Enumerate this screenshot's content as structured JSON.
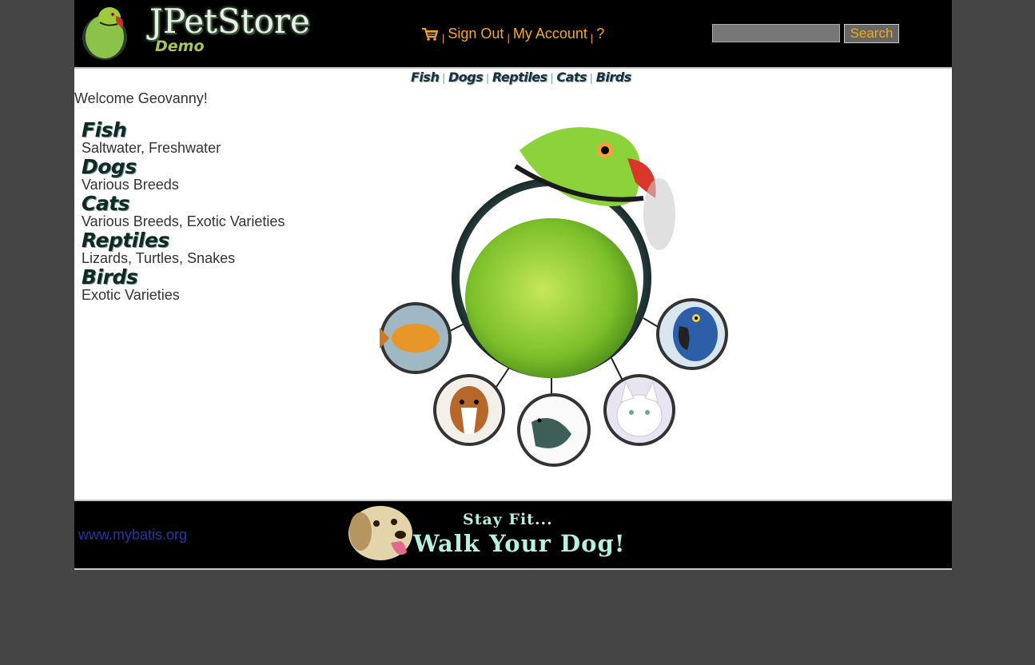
{
  "header": {
    "logo_title": "JPetStore",
    "logo_subtitle": "Demo",
    "menu": {
      "cart_icon": "shopping-cart-icon",
      "separator": "|",
      "sign_out": "Sign Out",
      "my_account": "My Account",
      "help": "?"
    },
    "search": {
      "input_value": "",
      "button_label": "Search"
    }
  },
  "quicklinks": [
    "Fish",
    "Dogs",
    "Reptiles",
    "Cats",
    "Birds"
  ],
  "welcome": "Welcome Geovanny!",
  "sidebar": {
    "categories": [
      {
        "name": "Fish",
        "description": "Saltwater, Freshwater"
      },
      {
        "name": "Dogs",
        "description": "Various Breeds"
      },
      {
        "name": "Cats",
        "description": "Various Breeds, Exotic Varieties"
      },
      {
        "name": "Reptiles",
        "description": "Lizards, Turtles, Snakes"
      },
      {
        "name": "Birds",
        "description": "Exotic Varieties"
      }
    ]
  },
  "footer": {
    "powered_by": "www.mybatis.org",
    "banner_line1": "Stay Fit...",
    "banner_line2": "Walk Your Dog!"
  },
  "colors": {
    "background": "#454545",
    "header_bg": "#000000",
    "link_orange": "#f7a81a",
    "footer_link": "#1c3aa8",
    "category_title": "#0e2a26"
  }
}
